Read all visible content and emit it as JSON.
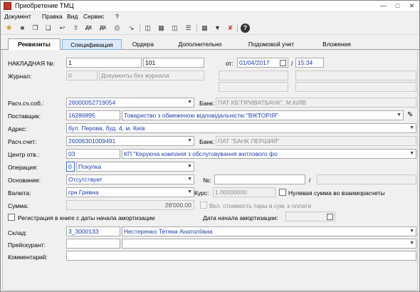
{
  "window": {
    "title": "Приобретение ТМЦ"
  },
  "menu": [
    "Документ",
    "Правка",
    "Вид",
    "Сервис",
    "?"
  ],
  "toolbar": {
    "icons": [
      "new-doc-icon",
      "folder-icon",
      "copy-icon",
      "paste-icon",
      "insert-icon",
      "move-up-icon",
      "dk-icon",
      "dk-alt-icon",
      "print-preview-icon",
      "save-icon",
      "columns-icon",
      "table-icon",
      "tree-icon",
      "list-icon",
      "filter-icon",
      "clear-filter-icon",
      "help-icon"
    ],
    "dk_label": "ДК"
  },
  "tabs": [
    "Реквизиты",
    "Спецификация",
    "Ордера",
    "Дополнительно",
    "Подомовой учет",
    "Вложения"
  ],
  "form": {
    "invoice_label": "НАКЛАДНАЯ №:",
    "invoice_prefix": "1",
    "invoice_number": "101",
    "date_label": "от:",
    "date_value": "01/04/2017",
    "time_sep": "/",
    "time_value": "15:34",
    "journal_label": "Журнал:",
    "journal_code": "0",
    "journal_name": "Документы без журнала",
    "own_account_label": "Расч.сч.соб.:",
    "own_account": "26000052719054",
    "bank_label": "Банк:",
    "own_bank": "ПАТ КБ\"ПРИВАТБАНК\", М.КИЇВ",
    "supplier_label": "Поставщик:",
    "supplier_code": "16286895",
    "supplier_name": "Товариство з обмеженою відповідальністю \"ВІКТОРІЯ\"",
    "address_label": "Адрес:",
    "address": "бул. Перова, буд. 4, м. Київ",
    "account_label": "Расч.счет:",
    "account": "26006301009491",
    "bank_label2": "Банк:",
    "bank": "ПАТ \"БАНК ПЕРШИЙ\"",
    "center_label": "Центр отв.:",
    "center_code": "03",
    "center_name": "КП \"Керуюча компанія з обслуговування житлового фо",
    "operation_label": "Операция:",
    "operation_code": "0",
    "operation_name": "Покупка",
    "basis_label": "Основание:",
    "basis": "Отсутствует",
    "number_label": "№:",
    "number_sep": "/",
    "currency_label": "Валюта:",
    "currency": "грн Гривна",
    "rate_label": "Курс:",
    "rate": "1.00000000",
    "zero_sum_label": "Нулевая сумма во взаиморасчеты",
    "sum_label": "Сумма:",
    "sum": "28'000.00",
    "tara_label": "Вкл. стоимость тары в сум. к оплате",
    "reg_label": "Регистрация в книге с даты начала амортизации",
    "amort_label": "Дата начала амортизации:",
    "warehouse_label": "Склад:",
    "warehouse_code": "3_3000133",
    "warehouse_name": "Нестеренко Тетяна Анатоліївна",
    "pricelist_label": "Прейскурант:",
    "comment_label": "Комментарий:"
  }
}
